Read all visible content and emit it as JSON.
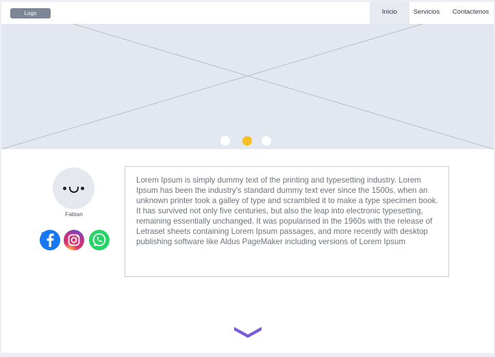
{
  "nav": {
    "logo": "Logo",
    "items": [
      {
        "label": "Inicio",
        "active": true
      },
      {
        "label": "Servicios"
      },
      {
        "label": "Contactenos"
      }
    ]
  },
  "hero": {
    "slides": 3,
    "active_slide": 2,
    "accent_color": "#f5c026"
  },
  "profile": {
    "name": "Fabian",
    "social": [
      {
        "icon": "facebook-icon",
        "color": "#1877f2"
      },
      {
        "icon": "instagram-icon",
        "color": "#c13584"
      },
      {
        "icon": "whatsapp-icon",
        "color": "#25d366"
      }
    ]
  },
  "content": {
    "text": "Lorem Ipsum is simply dummy text of the printing and typesetting industry. Lorem Ipsum has been the industry's standard dummy text ever since the 1500s, when an unknown printer took a galley of type and scrambled it to make a type specimen book. It has survived not only five centuries, but also the leap into electronic typesetting, remaining essentially unchanged. It was popularised in the 1960s with the release of Letraset sheets containing Lorem Ipsum passages, and more recently with desktop publishing software like Aldus PageMaker including versions of Lorem Ipsum"
  },
  "scroll": {
    "icon": "chevron-down-icon",
    "color": "#7a5bd6"
  }
}
